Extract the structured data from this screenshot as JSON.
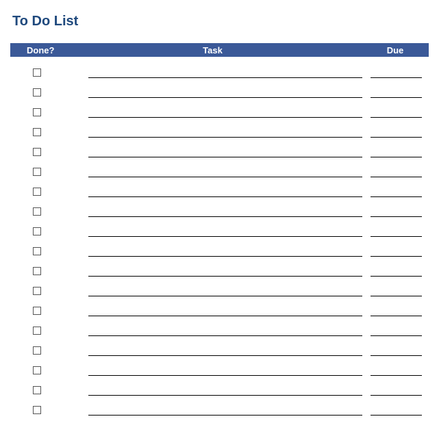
{
  "title": "To Do List",
  "header": {
    "done": "Done?",
    "task": "Task",
    "due": "Due"
  },
  "rows": [
    {
      "done": false,
      "task": "",
      "due": ""
    },
    {
      "done": false,
      "task": "",
      "due": ""
    },
    {
      "done": false,
      "task": "",
      "due": ""
    },
    {
      "done": false,
      "task": "",
      "due": ""
    },
    {
      "done": false,
      "task": "",
      "due": ""
    },
    {
      "done": false,
      "task": "",
      "due": ""
    },
    {
      "done": false,
      "task": "",
      "due": ""
    },
    {
      "done": false,
      "task": "",
      "due": ""
    },
    {
      "done": false,
      "task": "",
      "due": ""
    },
    {
      "done": false,
      "task": "",
      "due": ""
    },
    {
      "done": false,
      "task": "",
      "due": ""
    },
    {
      "done": false,
      "task": "",
      "due": ""
    },
    {
      "done": false,
      "task": "",
      "due": ""
    },
    {
      "done": false,
      "task": "",
      "due": ""
    },
    {
      "done": false,
      "task": "",
      "due": ""
    },
    {
      "done": false,
      "task": "",
      "due": ""
    },
    {
      "done": false,
      "task": "",
      "due": ""
    },
    {
      "done": false,
      "task": "",
      "due": ""
    }
  ]
}
